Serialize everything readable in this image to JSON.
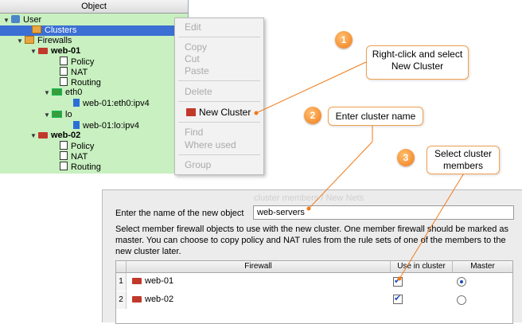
{
  "tree": {
    "header": "Object",
    "rows": [
      {
        "label": "User"
      },
      {
        "label": "Clusters"
      },
      {
        "label": "Firewalls"
      },
      {
        "label": "web-01"
      },
      {
        "label": "Policy"
      },
      {
        "label": "NAT"
      },
      {
        "label": "Routing"
      },
      {
        "label": "eth0"
      },
      {
        "label": "web-01:eth0:ipv4"
      },
      {
        "label": "lo"
      },
      {
        "label": "web-01:lo:ipv4"
      },
      {
        "label": "web-02"
      },
      {
        "label": "Policy"
      },
      {
        "label": "NAT"
      },
      {
        "label": "Routing"
      }
    ]
  },
  "menu": {
    "items": [
      "Edit",
      "Copy",
      "Cut",
      "Paste",
      "Delete",
      "New Cluster",
      "Find",
      "Where used",
      "Group"
    ]
  },
  "callouts": [
    {
      "num": "1",
      "text_line1": "Right-click and select",
      "text_line2": "New Cluster"
    },
    {
      "num": "2",
      "text_line1": "Enter cluster name"
    },
    {
      "num": "3",
      "text_line1": "Select cluster",
      "text_line2": "members"
    }
  ],
  "dialog": {
    "faded_title": "cluster members / New Nets",
    "name_label": "Enter the name of the new object",
    "name_value": "web-servers",
    "description": "Select member firewall objects to use with the new cluster. One member firewall should be marked as master. You can choose to copy policy and NAT rules from the rule sets of one of the members to the new cluster later.",
    "table": {
      "headers": [
        "Firewall",
        "Use in cluster",
        "Master"
      ],
      "rows": [
        {
          "num": "1",
          "name": "web-01",
          "use": true,
          "master": true
        },
        {
          "num": "2",
          "name": "web-02",
          "use": true,
          "master": false
        }
      ]
    }
  },
  "colors": {
    "tree_bg": "#c8f0c0",
    "selection": "#3b6fd4",
    "callout_orange": "#f07a1a"
  }
}
